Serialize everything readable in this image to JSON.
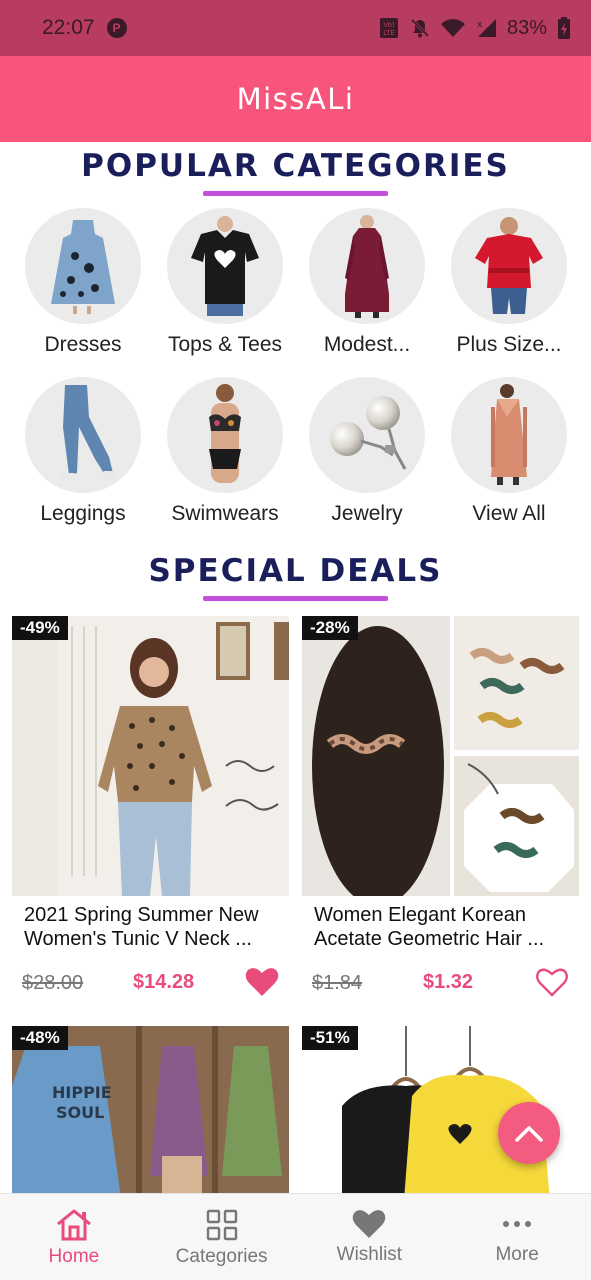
{
  "status_bar": {
    "time": "22:07",
    "battery": "83%"
  },
  "app_bar": {
    "title": "MissALi"
  },
  "popular": {
    "title": "POPULAR CATEGORIES",
    "categories": [
      {
        "label": "Dresses"
      },
      {
        "label": "Tops & Tees"
      },
      {
        "label": "Modest..."
      },
      {
        "label": "Plus Size..."
      },
      {
        "label": "Leggings"
      },
      {
        "label": "Swimwears"
      },
      {
        "label": "Jewelry"
      },
      {
        "label": "View All"
      }
    ]
  },
  "deals": {
    "title": "SPECIAL DEALS",
    "items": [
      {
        "badge": "-49%",
        "title": "2021 Spring Summer New Women's Tunic V Neck ...",
        "old_price": "$28.00",
        "new_price": "$14.28",
        "favorited": true
      },
      {
        "badge": "-28%",
        "title": "Women Elegant Korean Acetate Geometric Hair ...",
        "old_price": "$1.84",
        "new_price": "$1.32",
        "favorited": false
      },
      {
        "badge": "-48%"
      },
      {
        "badge": "-51%"
      }
    ]
  },
  "bottom_nav": {
    "items": [
      {
        "label": "Home",
        "icon": "home-icon",
        "active": true
      },
      {
        "label": "Categories",
        "icon": "grid-icon",
        "active": false
      },
      {
        "label": "Wishlist",
        "icon": "heart-icon",
        "active": false
      },
      {
        "label": "More",
        "icon": "more-dots-icon",
        "active": false
      }
    ]
  },
  "colors": {
    "status_bar": "#b83c5f",
    "app_bar": "#f8557d",
    "accent": "#e94c7b",
    "title_navy": "#1a1f5c",
    "underline": "#c24fd8"
  }
}
